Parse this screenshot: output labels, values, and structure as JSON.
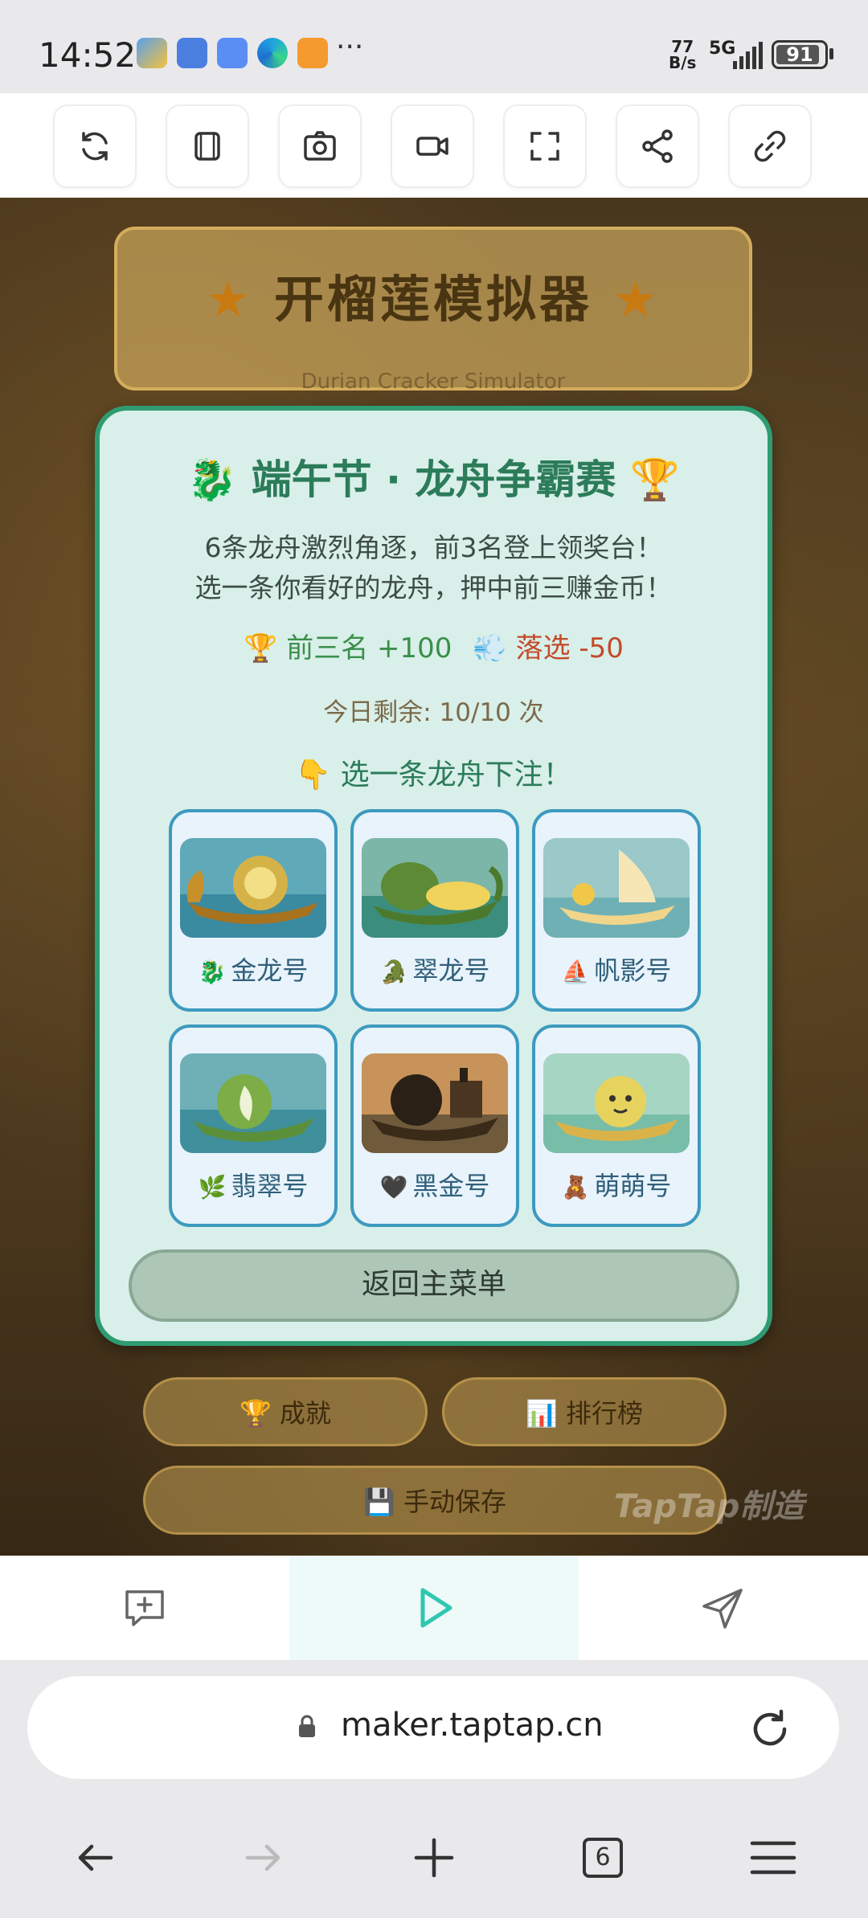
{
  "status_bar": {
    "time": "14:52",
    "net_speed_top": "77",
    "net_speed_bottom": "B/s",
    "network": "5G",
    "battery": "91",
    "battery_level": 0.91,
    "app_icons": [
      "weather-icon",
      "notes-icon",
      "messages-icon",
      "edge-icon",
      "search-app-icon"
    ]
  },
  "toolbar": {
    "items": [
      "refresh-icon",
      "layers-icon",
      "screenshot-icon",
      "record-icon",
      "fullscreen-icon",
      "share-icon",
      "link-icon"
    ]
  },
  "game": {
    "title": "开榴莲模拟器",
    "subtitle": "Durian Cracker Simulator",
    "achievements_label": "🏆 成就",
    "leaderboard_label": "📊 排行榜",
    "save_label": "💾 手动保存",
    "watermark": "TapTap制造"
  },
  "modal": {
    "title": "🐉 端午节 · 龙舟争霸赛 🏆",
    "desc_line1": "6条龙舟激烈角逐，前3名登上领奖台！",
    "desc_line2": "选一条你看好的龙舟，押中前三赚金币！",
    "reward_win": "🏆 前三名 +100",
    "reward_lose": "💨 落选 -50",
    "remaining": "今日剩余: 10/10 次",
    "prompt": "👇 选一条龙舟下注！",
    "boats": [
      {
        "emoji": "🐉",
        "name": "金龙号"
      },
      {
        "emoji": "🐊",
        "name": "翠龙号"
      },
      {
        "emoji": "⛵",
        "name": "帆影号"
      },
      {
        "emoji": "🌿",
        "name": "翡翠号"
      },
      {
        "emoji": "🖤",
        "name": "黑金号"
      },
      {
        "emoji": "🧸",
        "name": "萌萌号"
      }
    ],
    "back_label": "返回主菜单"
  },
  "bottom_nav": {
    "items": [
      "add-comment-icon",
      "play-icon",
      "send-icon"
    ],
    "active": "play-icon",
    "accent": "#2ec7b0"
  },
  "browser": {
    "url": "maker.taptap.cn",
    "tab_count": "6"
  }
}
